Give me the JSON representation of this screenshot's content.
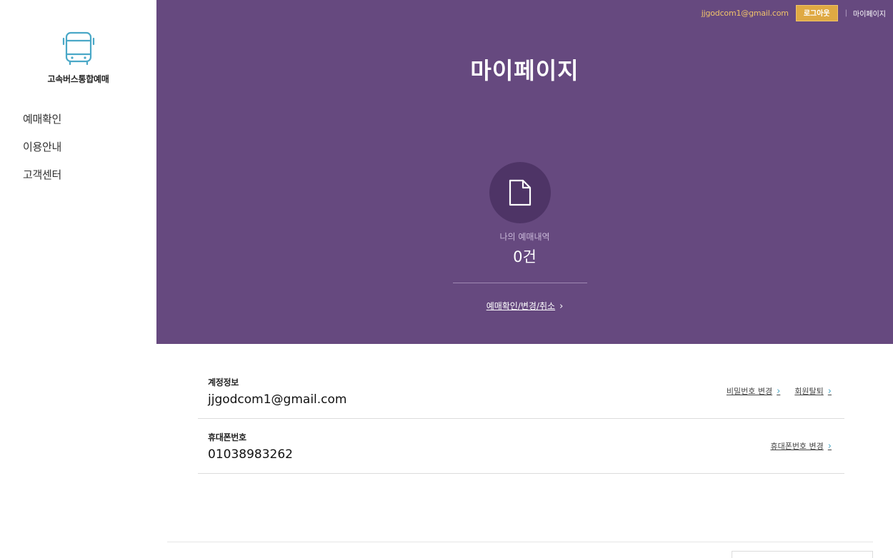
{
  "sidebar": {
    "logo_text": "고속버스통합예매",
    "items": [
      {
        "label": "예매확인"
      },
      {
        "label": "이용안내"
      },
      {
        "label": "고객센터"
      }
    ]
  },
  "topbar": {
    "email": "jjgodcom1@gmail.com",
    "logout": "로그아웃",
    "separator": "|",
    "mypage": "마이페이지"
  },
  "hero": {
    "title": "마이페이지",
    "icon": "document-icon",
    "history_label": "나의 예매내역",
    "history_count": "0건",
    "link": "예매확인/변경/취소"
  },
  "account": {
    "rows": [
      {
        "label": "계정정보",
        "value": "jjgodcom1@gmail.com",
        "actions": [
          "비밀번호 변경",
          "회원탈퇴"
        ]
      },
      {
        "label": "휴대폰번호",
        "value": "01038983262",
        "actions": [
          "휴대폰번호 변경"
        ]
      }
    ]
  },
  "colors": {
    "hero_bg": "#66497f",
    "accent_gold": "#dfa943",
    "icon_teal": "#4aa8c7"
  }
}
